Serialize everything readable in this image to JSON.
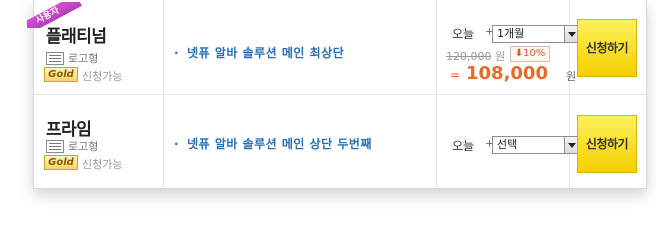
{
  "rows": [
    {
      "ribbon": "사용자",
      "name": "플래티넘",
      "logo_type": "로고형",
      "grade": "Gold",
      "apply_status": "신청가능",
      "description": "넷퓨 알바 솔루션 메인 최상단",
      "today_label": "오늘",
      "plus": "+",
      "period_selected": "1개월",
      "original_price": "120,000",
      "original_price_unit": "원",
      "discount": "10%",
      "equals": "=",
      "final_price": "108,000",
      "final_price_unit": "원",
      "apply_button": "신청하기"
    },
    {
      "name": "프라임",
      "logo_type": "로고형",
      "grade": "Gold",
      "apply_status": "신청가능",
      "description": "넷퓨 알바 솔루션 메인 상단 두번째",
      "today_label": "오늘",
      "plus": "+",
      "period_selected": "선택",
      "apply_button": "신청하기"
    }
  ],
  "colors": {
    "accent_blue": "#2a6fb5",
    "price_orange": "#e86a2a",
    "button_yellow": "#f4cf00",
    "ribbon_purple": "#c043c6"
  },
  "icons": {
    "logo_type_icon": "list-card-icon",
    "discount_arrow": "arrow-down-icon",
    "select_arrow": "chevron-down-icon"
  }
}
